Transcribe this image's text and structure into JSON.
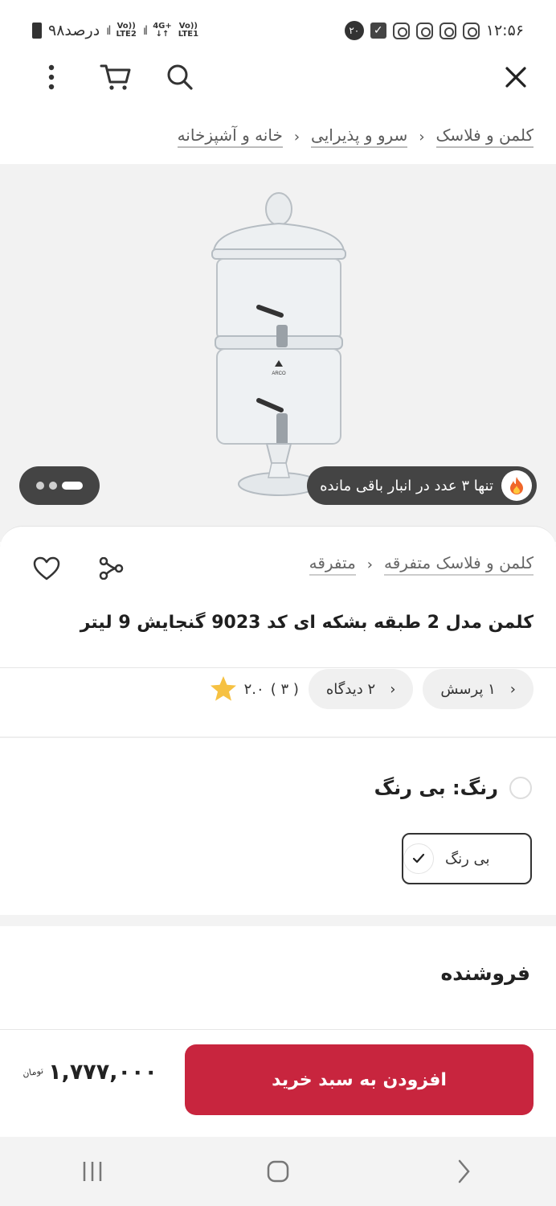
{
  "status_bar": {
    "time": "۱۲:۵۶",
    "battery": "۹۸درصد",
    "notification_count": "۲۰",
    "net1_top": "Vo))",
    "net1_bottom": "LTE2",
    "net2_top": "4G+",
    "net2_bottom": "↓↑",
    "net3_top": "Vo))",
    "net3_bottom": "LTE1"
  },
  "toolbar": {
    "close_icon": "close-icon",
    "search_icon": "search-icon",
    "cart_icon": "cart-icon",
    "more_icon": "more-vertical-icon"
  },
  "breadcrumb": {
    "items": [
      "خانه و آشپزخانه",
      "سرو و پذیرایی",
      "کلمن و فلاسک"
    ]
  },
  "gallery": {
    "stock_text": "تنها ۳ عدد در انبار باقی مانده",
    "page_count": 3,
    "active_page": 1,
    "brand_mark": "ARCO"
  },
  "product": {
    "categories": [
      "متفرقه",
      "کلمن و فلاسک متفرقه"
    ],
    "title": "کلمن مدل 2 طبقه بشکه ای کد 9023 گنجایش 9 لیتر",
    "rating": "۲.۰",
    "rating_count": "( ۳ )",
    "reviews_chip": "۲ دیدگاه",
    "questions_chip": "۱ پرسش"
  },
  "color": {
    "label": "رنگ: بی رنگ",
    "option": "بی رنگ"
  },
  "seller": {
    "title": "فروشنده"
  },
  "buy": {
    "button": "افزودن به سبد خرید",
    "price": "۱,۷۷۷,۰۰۰",
    "currency": "تومان"
  },
  "colors": {
    "accent": "#c8253e",
    "chip_bg": "#f0f0f0",
    "pill_bg": "#444444",
    "star": "#f6c142"
  }
}
